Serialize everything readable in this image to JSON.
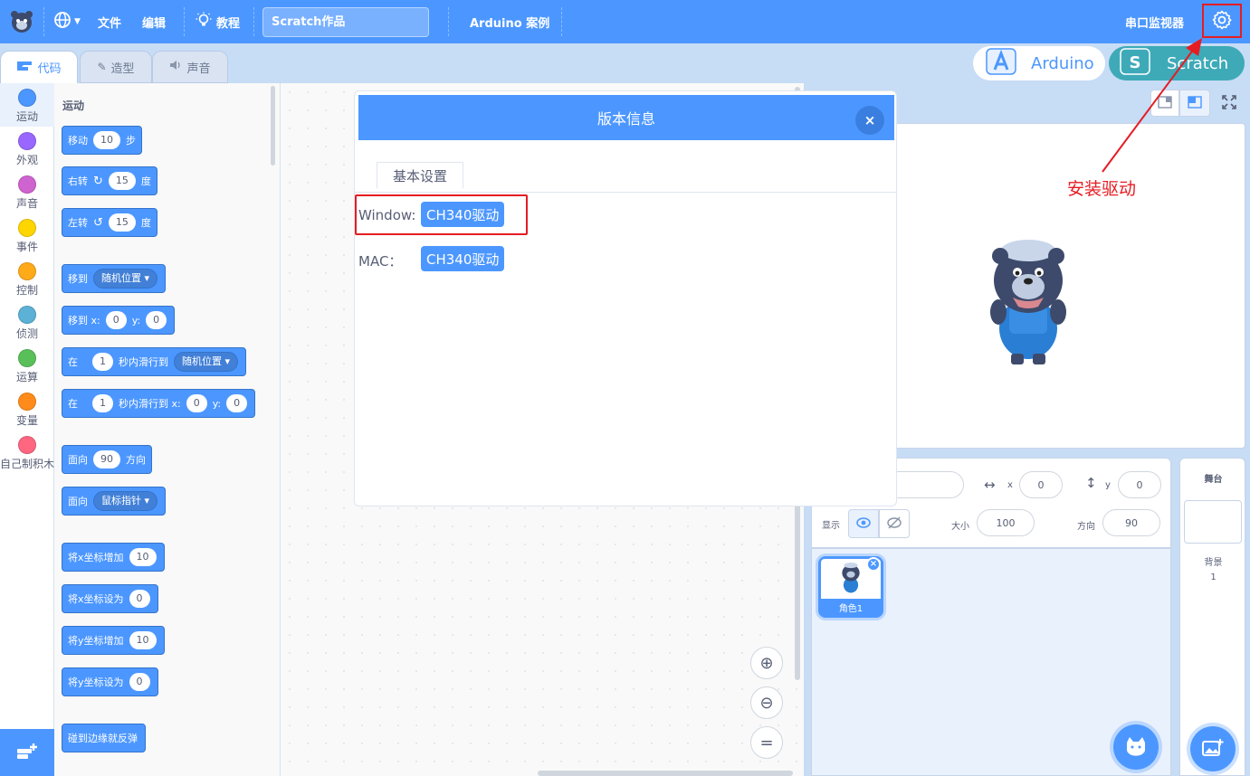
{
  "menu": {
    "file": "文件",
    "edit": "编辑",
    "tutorial": "教程",
    "project_title": "Scratch作品",
    "arduino_examples": "Arduino 案例",
    "serial_monitor": "串口监视器"
  },
  "mode": {
    "arduino": "Arduino",
    "scratch": "Scratch"
  },
  "tabs": {
    "code": "代码",
    "costumes": "造型",
    "sounds": "声音"
  },
  "categories": [
    {
      "label": "运动",
      "color": "#4c97ff"
    },
    {
      "label": "外观",
      "color": "#9966ff"
    },
    {
      "label": "声音",
      "color": "#cf63cf"
    },
    {
      "label": "事件",
      "color": "#ffd500"
    },
    {
      "label": "控制",
      "color": "#ffab19"
    },
    {
      "label": "侦测",
      "color": "#5cb1d6"
    },
    {
      "label": "运算",
      "color": "#59c059"
    },
    {
      "label": "变量",
      "color": "#ff8c1a"
    },
    {
      "label": "自己制积木",
      "color": "#ff6680"
    }
  ],
  "palette": {
    "section": "运动",
    "move": {
      "a": "移动",
      "n": "10",
      "b": "步"
    },
    "turn_right": {
      "a": "右转",
      "n": "15",
      "b": "度"
    },
    "turn_left": {
      "a": "左转",
      "n": "15",
      "b": "度"
    },
    "goto": {
      "a": "移到",
      "dd": "随机位置"
    },
    "goto_xy": {
      "a": "移到 x:",
      "x": "0",
      "b": "y:",
      "y": "0"
    },
    "glide": {
      "a": "在",
      "n": "1",
      "b": "秒内滑行到",
      "dd": "随机位置"
    },
    "glide_xy": {
      "a": "在",
      "n": "1",
      "b": "秒内滑行到 x:",
      "x": "0",
      "c": "y:",
      "y": "0"
    },
    "point_dir": {
      "a": "面向",
      "n": "90",
      "b": "方向"
    },
    "point_towards": {
      "a": "面向",
      "dd": "鼠标指针"
    },
    "change_x": {
      "a": "将x坐标增加",
      "n": "10"
    },
    "set_x": {
      "a": "将x坐标设为",
      "n": "0"
    },
    "change_y": {
      "a": "将y坐标增加",
      "n": "10"
    },
    "set_y": {
      "a": "将y坐标设为",
      "n": "0"
    },
    "bounce": "碰到边缘就反弹"
  },
  "sprite": {
    "x_label": "x",
    "x": "0",
    "y_label": "y",
    "y": "0",
    "show_label": "显示",
    "size_label": "大小",
    "size": "100",
    "dir_label": "方向",
    "dir": "90",
    "name": "角色1"
  },
  "stage_panel": {
    "title": "舞台",
    "backdrop_label": "背景",
    "backdrop_count": "1"
  },
  "annotation": "安装驱动",
  "dialog": {
    "title": "版本信息",
    "close": "×",
    "tab": "基本设置",
    "window_label": "Window:",
    "window_button": "CH340驱动",
    "mac_label": "MAC：",
    "mac_button": "CH340驱动"
  },
  "colors": {
    "primary": "#4c97ff",
    "highlight": "#e51c23",
    "arduino_mode": "#ffffff",
    "scratch_mode": "#3eaab8"
  }
}
